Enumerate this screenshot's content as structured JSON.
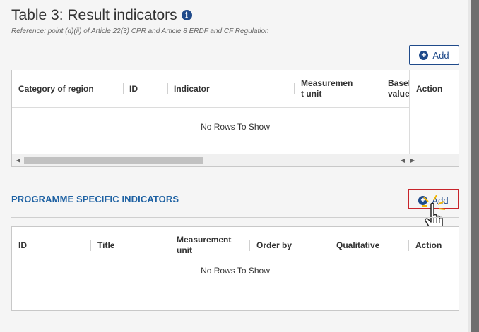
{
  "header": {
    "title": "Table 3: Result indicators",
    "info_icon": "i",
    "reference": "Reference: point (d)(ii) of Article 22(3) CPR and Article 8 ERDF and CF Regulation"
  },
  "result_indicators": {
    "add_label": "Add",
    "columns": [
      "Category of region",
      "ID",
      "Indicator",
      "Measuremen\nt unit",
      "Basel\nvalue",
      "Action"
    ],
    "empty_text": "No Rows To Show"
  },
  "programme_specific": {
    "section_title": "PROGRAMME SPECIFIC INDICATORS",
    "add_label": "Add",
    "columns": [
      "ID",
      "Title",
      "Measurement\nunit",
      "Order by",
      "Qualitative",
      "Action"
    ],
    "empty_text": "No Rows To Show"
  },
  "colors": {
    "accent": "#1f4a8a",
    "section_title": "#1f62a3",
    "highlight": "#c8242b"
  },
  "icons": [
    "info-icon",
    "plus-circle-icon",
    "hand-pointer-icon",
    "arrow-left-icon",
    "arrow-right-icon"
  ]
}
